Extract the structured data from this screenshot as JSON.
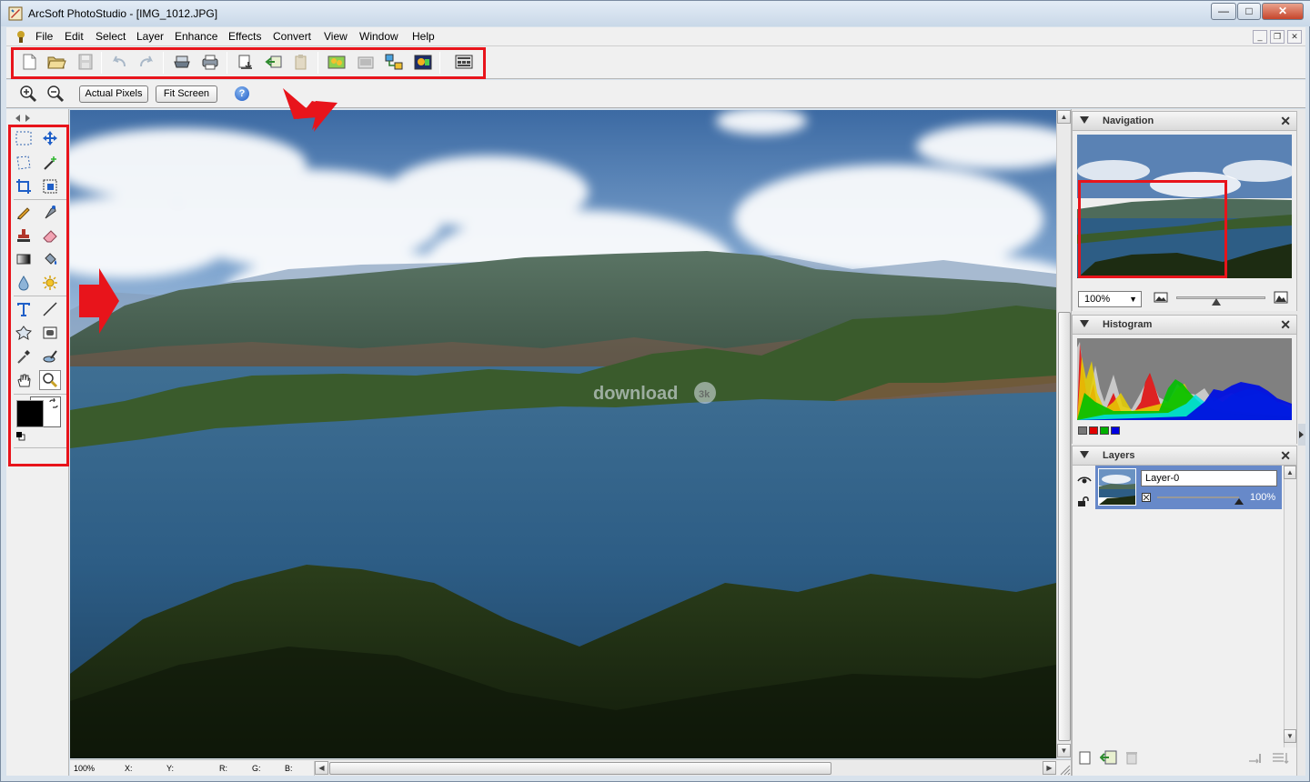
{
  "window": {
    "title": "ArcSoft PhotoStudio - [IMG_1012.JPG]",
    "caption_minimize": "—",
    "caption_maximize": "□",
    "caption_close": "✕"
  },
  "menubar": {
    "items": [
      "File",
      "Edit",
      "Select",
      "Layer",
      "Enhance",
      "Effects",
      "Convert",
      "View",
      "Window",
      "Help"
    ],
    "mdi_minimize": "_",
    "mdi_restore": "❐",
    "mdi_close": "✕"
  },
  "toolbar": {
    "icons": [
      "new-file-icon",
      "open-file-icon",
      "save-icon",
      "undo-icon",
      "redo-icon",
      "scan-icon",
      "print-icon",
      "import-icon",
      "copy-icon",
      "paste-icon",
      "photo-icon",
      "slideshow-icon",
      "organize-icon",
      "photo-edit-icon",
      "filmstrip-icon"
    ]
  },
  "optionbar": {
    "actual_pixels": "Actual Pixels",
    "fit_screen": "Fit Screen",
    "help": "?"
  },
  "canvas": {
    "watermark": "download",
    "watermark_badge": "3k"
  },
  "statusbar": {
    "zoom": "100%",
    "x": "X:",
    "y": "Y:",
    "r": "R:",
    "g": "G:",
    "b": "B:"
  },
  "panels": {
    "navigation": {
      "title": "Navigation",
      "zoom": "100%",
      "zoom_level": 0.45
    },
    "histogram": {
      "title": "Histogram",
      "channel_colors": [
        "#777777",
        "#e00000",
        "#00b000",
        "#0000e0"
      ]
    },
    "layers": {
      "title": "Layers",
      "layer_name": "Layer-0",
      "opacity": "100%",
      "opacity_level": 1.0
    }
  },
  "colors": {
    "highlight": "#e8141b",
    "foreground": "#000000",
    "background": "#ffffff"
  }
}
